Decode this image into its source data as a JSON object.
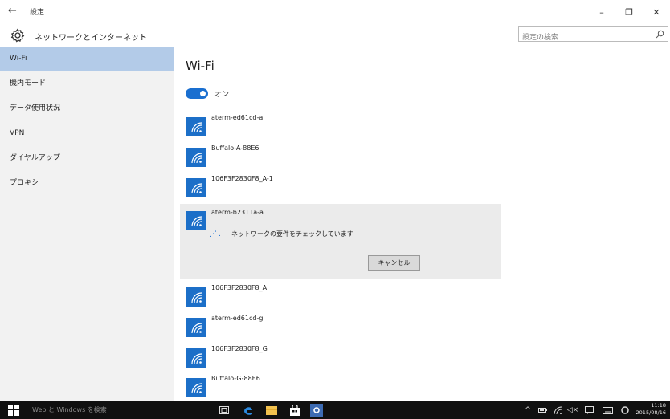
{
  "window": {
    "title": "設定",
    "back_glyph": "←",
    "minimize_glyph": "–",
    "maximize_glyph": "❐",
    "close_glyph": "✕"
  },
  "header": {
    "title": "ネットワークとインターネット",
    "search_placeholder": "設定の検索"
  },
  "sidebar": {
    "items": [
      {
        "label": "Wi-Fi"
      },
      {
        "label": "機内モード"
      },
      {
        "label": "データ使用状況"
      },
      {
        "label": "VPN"
      },
      {
        "label": "ダイヤルアップ"
      },
      {
        "label": "プロキシ"
      }
    ],
    "active_index": 0
  },
  "main": {
    "title": "Wi-Fi",
    "toggle": {
      "label": "オン",
      "on": true
    },
    "networks": [
      {
        "name": "aterm-ed61cd-a"
      },
      {
        "name": "Buffalo-A-88E6"
      },
      {
        "name": "106F3F2830F8_A-1"
      },
      {
        "name": "aterm-b2311a-a"
      },
      {
        "name": "106F3F2830F8_A"
      },
      {
        "name": "aterm-ed61cd-g"
      },
      {
        "name": "106F3F2830F8_G"
      },
      {
        "name": "Buffalo-G-88E6"
      }
    ],
    "connecting": {
      "network_index": 3,
      "status": "ネットワークの要件をチェックしています",
      "cancel_label": "キャンセル"
    }
  },
  "taskbar": {
    "search_text": "Web と Windows を検索",
    "time": "11:18",
    "date": "2015/08/16"
  },
  "colors": {
    "accent": "#1a6fd0",
    "sidebar_active": "#b3cbe8",
    "taskbar": "#101010"
  }
}
